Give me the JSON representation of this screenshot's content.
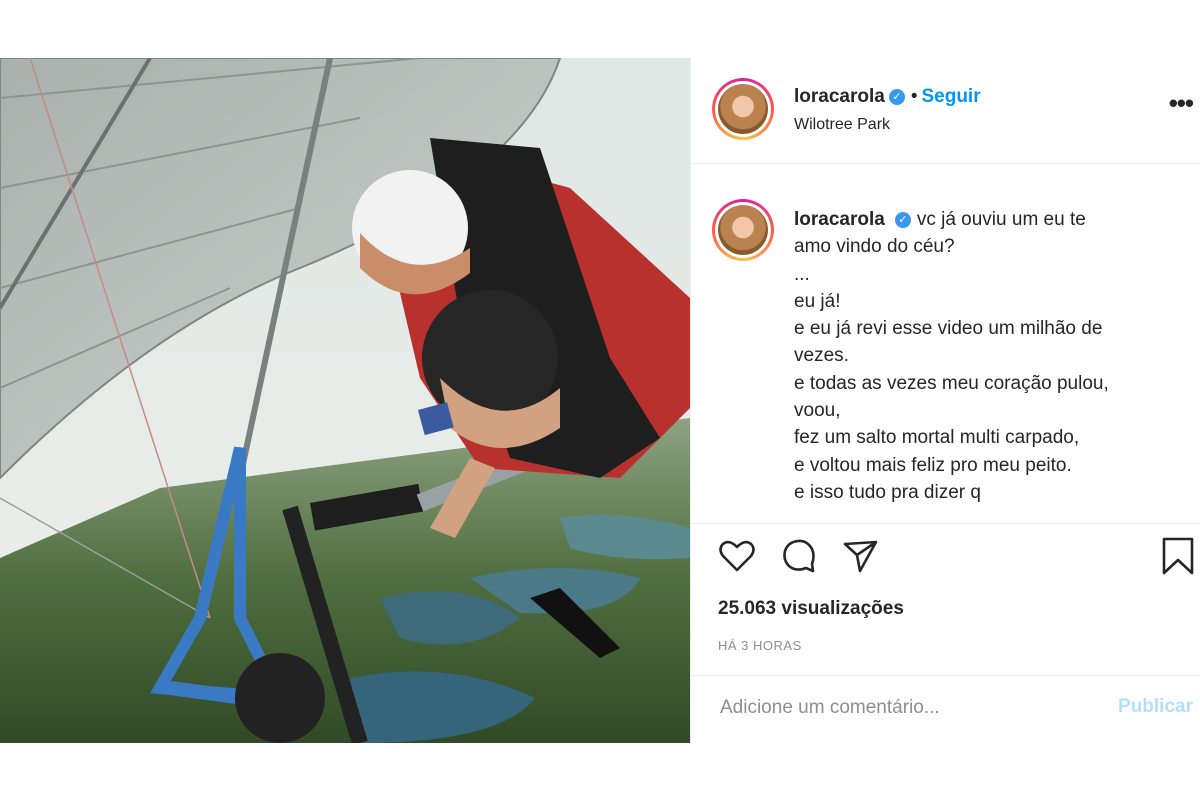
{
  "post": {
    "username": "loracarola",
    "follow_label": "Seguir",
    "separator": "•",
    "location": "Wilotree Park",
    "more_label": "•••",
    "caption": {
      "username": "loracarola",
      "lines": [
        "vc já ouviu um eu te",
        "amo vindo do céu?",
        "...",
        "eu já!",
        "e eu já revi esse video um milhão de",
        "vezes.",
        "e todas as vezes meu coração pulou,",
        "voou,",
        "fez um salto mortal multi carpado,",
        "e voltou mais feliz pro meu peito.",
        "e isso tudo pra dizer q"
      ]
    },
    "icons": [
      "heart-icon",
      "comment-icon",
      "share-icon",
      "bookmark-icon"
    ],
    "views": "25.063 visualizações",
    "time": "HÁ 3 HORAS",
    "comment_placeholder": "Adicione um comentário...",
    "publish_label": "Publicar"
  },
  "colors": {
    "accent": "#0095f6",
    "verified": "#3897f0",
    "publish_disabled": "#b2dffc",
    "muted": "#8e8e8e"
  }
}
